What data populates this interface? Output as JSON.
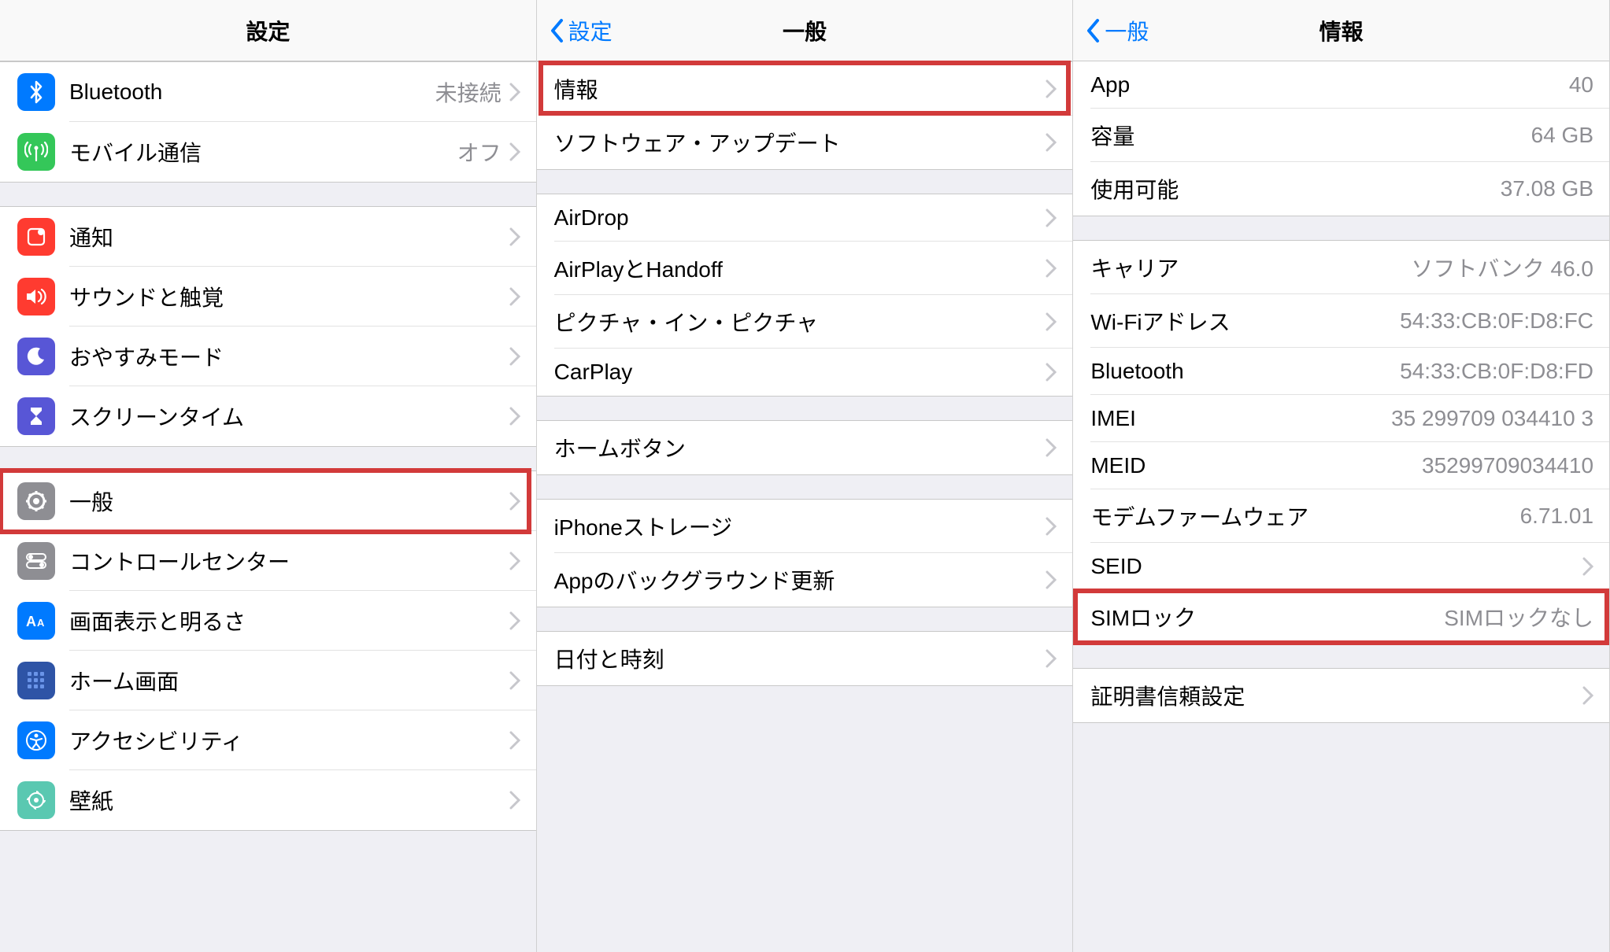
{
  "panel1": {
    "title": "設定",
    "rows1": [
      {
        "label": "Bluetooth",
        "value": "未接続",
        "icon": "bluetooth-icon",
        "bg": "bg-blue"
      },
      {
        "label": "モバイル通信",
        "value": "オフ",
        "icon": "antenna-icon",
        "bg": "bg-green"
      }
    ],
    "rows2": [
      {
        "label": "通知",
        "icon": "notification-icon",
        "bg": "bg-redoran"
      },
      {
        "label": "サウンドと触覚",
        "icon": "sound-icon",
        "bg": "bg-red"
      },
      {
        "label": "おやすみモード",
        "icon": "moon-icon",
        "bg": "bg-purple"
      },
      {
        "label": "スクリーンタイム",
        "icon": "hourglass-icon",
        "bg": "bg-purple"
      }
    ],
    "rows3": [
      {
        "label": "一般",
        "icon": "gear-icon",
        "bg": "bg-gray",
        "highlighted": true
      },
      {
        "label": "コントロールセンター",
        "icon": "switches-icon",
        "bg": "bg-gray"
      },
      {
        "label": "画面表示と明るさ",
        "icon": "text-size-icon",
        "bg": "bg-lightblue"
      },
      {
        "label": "ホーム画面",
        "icon": "grid-icon",
        "bg": "bg-navy"
      },
      {
        "label": "アクセシビリティ",
        "icon": "accessibility-icon",
        "bg": "bg-lightblue"
      },
      {
        "label": "壁紙",
        "icon": "wallpaper-icon",
        "bg": "bg-teal"
      }
    ]
  },
  "panel2": {
    "back": "設定",
    "title": "一般",
    "rows1": [
      {
        "label": "情報",
        "highlighted": true
      },
      {
        "label": "ソフトウェア・アップデート"
      }
    ],
    "rows2": [
      {
        "label": "AirDrop"
      },
      {
        "label": "AirPlayとHandoff"
      },
      {
        "label": "ピクチャ・イン・ピクチャ"
      },
      {
        "label": "CarPlay"
      }
    ],
    "rows3": [
      {
        "label": "ホームボタン"
      }
    ],
    "rows4": [
      {
        "label": "iPhoneストレージ"
      },
      {
        "label": "Appのバックグラウンド更新"
      }
    ],
    "rows5": [
      {
        "label": "日付と時刻"
      }
    ]
  },
  "panel3": {
    "back": "一般",
    "title": "情報",
    "rows1": [
      {
        "label": "App",
        "value": "40"
      },
      {
        "label": "容量",
        "value": "64 GB"
      },
      {
        "label": "使用可能",
        "value": "37.08 GB"
      }
    ],
    "rows2": [
      {
        "label": "キャリア",
        "value": "ソフトバンク 46.0"
      },
      {
        "label": "Wi-Fiアドレス",
        "value": "54:33:CB:0F:D8:FC"
      },
      {
        "label": "Bluetooth",
        "value": "54:33:CB:0F:D8:FD"
      },
      {
        "label": "IMEI",
        "value": "35 299709 034410 3"
      },
      {
        "label": "MEID",
        "value": "35299709034410"
      },
      {
        "label": "モデムファームウェア",
        "value": "6.71.01"
      },
      {
        "label": "SEID",
        "value": "",
        "chevron": true
      },
      {
        "label": "SIMロック",
        "value": "SIMロックなし",
        "highlighted": true
      }
    ],
    "rows3": [
      {
        "label": "証明書信頼設定",
        "chevron": true
      }
    ]
  }
}
